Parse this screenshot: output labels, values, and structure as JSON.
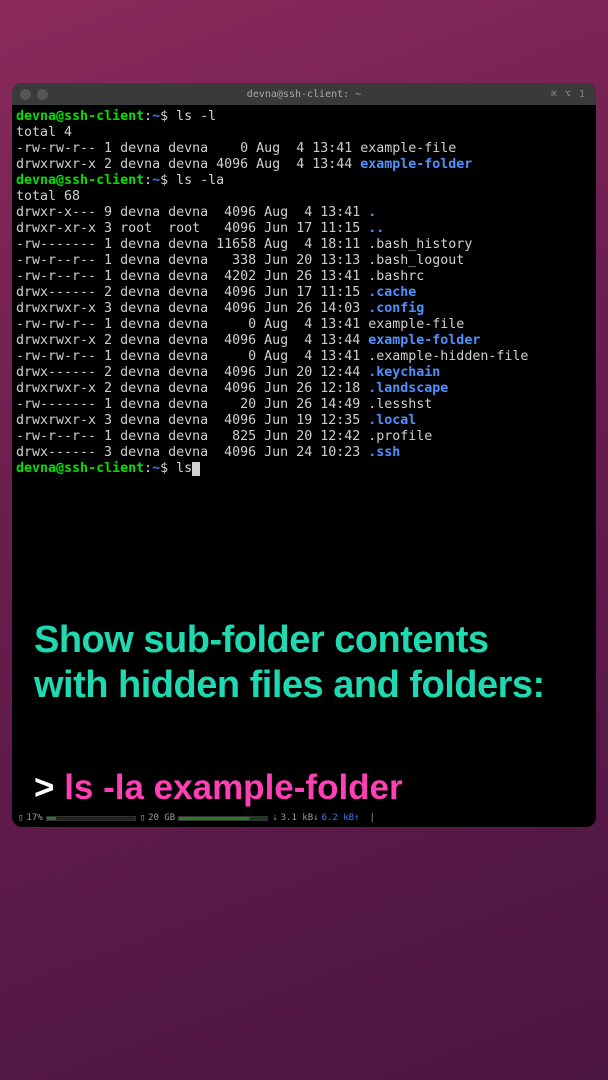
{
  "titlebar": {
    "title": "devna@ssh-client: ~",
    "right_indicator": "⌘ ⌥ 1"
  },
  "prompt": {
    "user": "devna",
    "at": "@",
    "host": "ssh-client",
    "colon": ":",
    "path": "~",
    "dollar": "$"
  },
  "commands": {
    "cmd1": "ls -l",
    "cmd2": "ls -la",
    "cmd3_partial": "ls"
  },
  "totals": {
    "t1": "total 4",
    "t2": "total 68"
  },
  "listing1": [
    {
      "perms": "-rw-rw-r--",
      "links": "1",
      "own": "devna",
      "grp": "devna",
      "size": "   0",
      "date": "Aug  4 13:41",
      "name": "example-file",
      "type": "file"
    },
    {
      "perms": "drwxrwxr-x",
      "links": "2",
      "own": "devna",
      "grp": "devna",
      "size": "4096",
      "date": "Aug  4 13:44",
      "name": "example-folder",
      "type": "dir"
    }
  ],
  "listing2": [
    {
      "perms": "drwxr-x---",
      "links": "9",
      "own": "devna",
      "grp": "devna",
      "size": " 4096",
      "date": "Aug  4 13:41",
      "name": ".",
      "type": "dir"
    },
    {
      "perms": "drwxr-xr-x",
      "links": "3",
      "own": "root ",
      "grp": "root ",
      "size": " 4096",
      "date": "Jun 17 11:15",
      "name": "..",
      "type": "dir"
    },
    {
      "perms": "-rw-------",
      "links": "1",
      "own": "devna",
      "grp": "devna",
      "size": "11658",
      "date": "Aug  4 18:11",
      "name": ".bash_history",
      "type": "file"
    },
    {
      "perms": "-rw-r--r--",
      "links": "1",
      "own": "devna",
      "grp": "devna",
      "size": "  338",
      "date": "Jun 20 13:13",
      "name": ".bash_logout",
      "type": "file"
    },
    {
      "perms": "-rw-r--r--",
      "links": "1",
      "own": "devna",
      "grp": "devna",
      "size": " 4202",
      "date": "Jun 26 13:41",
      "name": ".bashrc",
      "type": "file"
    },
    {
      "perms": "drwx------",
      "links": "2",
      "own": "devna",
      "grp": "devna",
      "size": " 4096",
      "date": "Jun 17 11:15",
      "name": ".cache",
      "type": "dir"
    },
    {
      "perms": "drwxrwxr-x",
      "links": "3",
      "own": "devna",
      "grp": "devna",
      "size": " 4096",
      "date": "Jun 26 14:03",
      "name": ".config",
      "type": "dir"
    },
    {
      "perms": "-rw-rw-r--",
      "links": "1",
      "own": "devna",
      "grp": "devna",
      "size": "    0",
      "date": "Aug  4 13:41",
      "name": "example-file",
      "type": "file"
    },
    {
      "perms": "drwxrwxr-x",
      "links": "2",
      "own": "devna",
      "grp": "devna",
      "size": " 4096",
      "date": "Aug  4 13:44",
      "name": "example-folder",
      "type": "dir"
    },
    {
      "perms": "-rw-rw-r--",
      "links": "1",
      "own": "devna",
      "grp": "devna",
      "size": "    0",
      "date": "Aug  4 13:41",
      "name": ".example-hidden-file",
      "type": "file"
    },
    {
      "perms": "drwx------",
      "links": "2",
      "own": "devna",
      "grp": "devna",
      "size": " 4096",
      "date": "Jun 20 12:44",
      "name": ".keychain",
      "type": "dir"
    },
    {
      "perms": "drwxrwxr-x",
      "links": "2",
      "own": "devna",
      "grp": "devna",
      "size": " 4096",
      "date": "Jun 26 12:18",
      "name": ".landscape",
      "type": "dir"
    },
    {
      "perms": "-rw-------",
      "links": "1",
      "own": "devna",
      "grp": "devna",
      "size": "   20",
      "date": "Jun 26 14:49",
      "name": ".lesshst",
      "type": "file"
    },
    {
      "perms": "drwxrwxr-x",
      "links": "3",
      "own": "devna",
      "grp": "devna",
      "size": " 4096",
      "date": "Jun 19 12:35",
      "name": ".local",
      "type": "dir"
    },
    {
      "perms": "-rw-r--r--",
      "links": "1",
      "own": "devna",
      "grp": "devna",
      "size": "  825",
      "date": "Jun 20 12:42",
      "name": ".profile",
      "type": "file"
    },
    {
      "perms": "drwx------",
      "links": "3",
      "own": "devna",
      "grp": "devna",
      "size": " 4096",
      "date": "Jun 24 10:23",
      "name": ".ssh",
      "type": "dir"
    }
  ],
  "overlay": {
    "line1": "Show sub-folder contents",
    "line2": "with hidden files and folders:",
    "prompt": ">",
    "command": "ls -la example-folder"
  },
  "statusbar": {
    "battery_icon": "▯",
    "battery_pct": "17%",
    "disk_icon": "▯",
    "disk_val": "20 GB",
    "net_down_icon": "⇣",
    "net_down": "3.1 kB↓",
    "net_up": "6.2 kB↑",
    "sep": "|"
  }
}
